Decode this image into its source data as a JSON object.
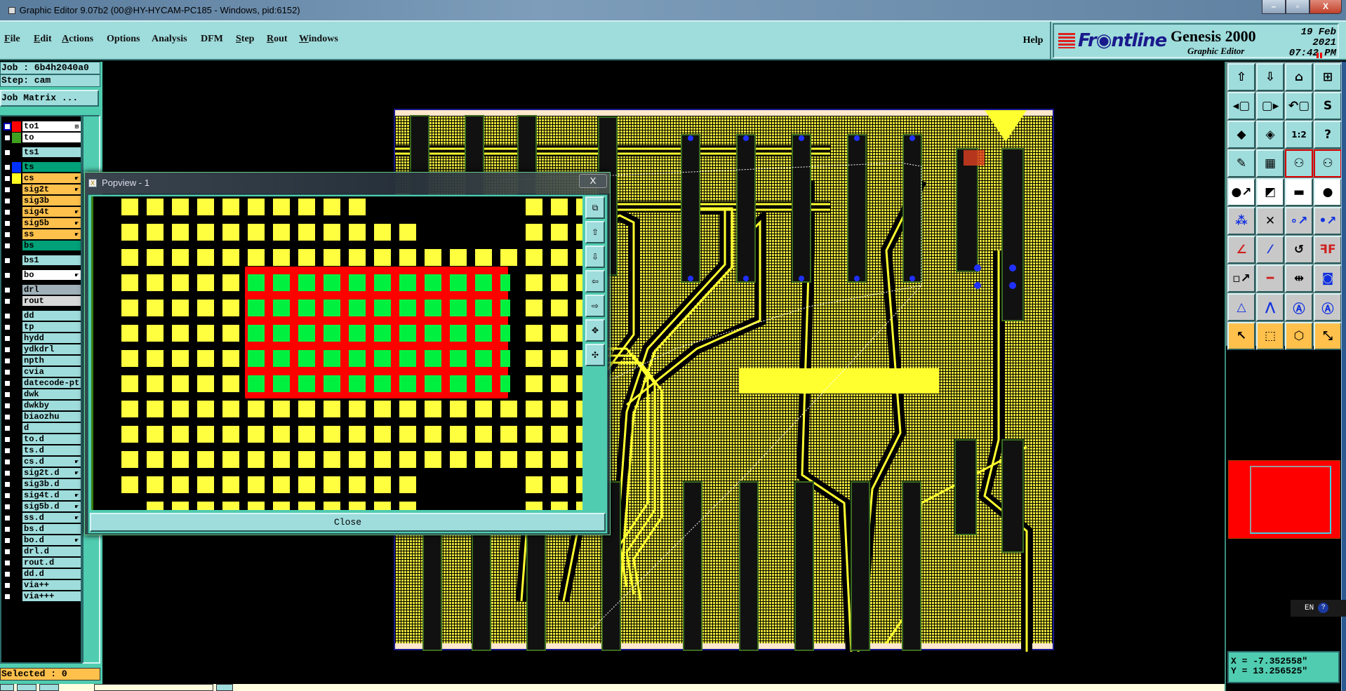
{
  "window": {
    "title": "Graphic Editor 9.07b2 (00@HY-HYCAM-PC185 - Windows, pid:6152)",
    "minimize": "–",
    "maximize": "▫",
    "close": "X"
  },
  "menu": {
    "items": [
      {
        "label": "File",
        "u": "F",
        "rest": "ile"
      },
      {
        "label": "Edit",
        "u": "E",
        "rest": "dit"
      },
      {
        "label": "Actions",
        "u": "A",
        "rest": "ctions"
      },
      {
        "label": "Options",
        "u": "",
        "rest": "Options"
      },
      {
        "label": "Analysis",
        "u": "",
        "rest": "Analysis"
      },
      {
        "label": "DFM",
        "u": "",
        "rest": "DFM"
      },
      {
        "label": "Step",
        "u": "S",
        "rest": "tep"
      },
      {
        "label": "Rout",
        "u": "R",
        "rest": "out"
      },
      {
        "label": "Windows",
        "u": "W",
        "rest": "indows"
      }
    ],
    "help": "Help"
  },
  "logo": {
    "brand": "Fr◉ntline",
    "product": "Genesis 2000",
    "subtitle": "Graphic Editor",
    "date": "19 Feb 2021",
    "time": "07:42 PM"
  },
  "job": {
    "job_line": "Job : 6b4h2040a0",
    "step_line": "Step: cam",
    "matrix_button": "Job Matrix ..."
  },
  "layers": [
    {
      "name": "to1",
      "swatch": "#ff0000",
      "bg": "#ffffff",
      "mark": "⊞",
      "cbborder": "#0000c0"
    },
    {
      "name": "to",
      "swatch": "#40a020",
      "bg": "#ffffff"
    },
    {
      "name": "ts1",
      "bg": "#9fdcdc"
    },
    {
      "name": "ts",
      "swatch": "#0030ff",
      "bg": "#00a078"
    },
    {
      "name": "cs",
      "swatch": "#ffff20",
      "bg": "#ffc04c",
      "hand": true
    },
    {
      "name": "sig2t",
      "bg": "#ffc04c",
      "hand": true
    },
    {
      "name": "sig3b",
      "bg": "#ffc04c"
    },
    {
      "name": "sig4t",
      "bg": "#ffc04c",
      "hand": true
    },
    {
      "name": "sig5b",
      "bg": "#ffc04c",
      "hand": true
    },
    {
      "name": "ss",
      "bg": "#ffc04c",
      "hand": true
    },
    {
      "name": "bs",
      "bg": "#00a078"
    },
    {
      "name": "bs1",
      "bg": "#9fdcdc"
    },
    {
      "name": "bo",
      "bg": "#ffffff",
      "hand": true
    },
    {
      "name": "drl",
      "bg": "#a0b0b8"
    },
    {
      "name": "rout",
      "bg": "#d8d8d8"
    },
    {
      "name": "dd",
      "bg": "#9fdcdc"
    },
    {
      "name": "tp",
      "bg": "#9fdcdc"
    },
    {
      "name": "hydd",
      "bg": "#9fdcdc"
    },
    {
      "name": "ydkdrl",
      "bg": "#9fdcdc"
    },
    {
      "name": "npth",
      "bg": "#9fdcdc"
    },
    {
      "name": "cvia",
      "bg": "#9fdcdc"
    },
    {
      "name": "datecode-pt",
      "bg": "#9fdcdc"
    },
    {
      "name": "dwk",
      "bg": "#9fdcdc"
    },
    {
      "name": "dwkby",
      "bg": "#9fdcdc"
    },
    {
      "name": "biaozhu",
      "bg": "#9fdcdc"
    },
    {
      "name": "d",
      "bg": "#9fdcdc"
    },
    {
      "name": "to.d",
      "bg": "#9fdcdc"
    },
    {
      "name": "ts.d",
      "bg": "#9fdcdc"
    },
    {
      "name": "cs.d",
      "bg": "#9fdcdc",
      "hand": true
    },
    {
      "name": "sig2t.d",
      "bg": "#9fdcdc",
      "hand": true
    },
    {
      "name": "sig3b.d",
      "bg": "#9fdcdc"
    },
    {
      "name": "sig4t.d",
      "bg": "#9fdcdc",
      "hand": true
    },
    {
      "name": "sig5b.d",
      "bg": "#9fdcdc",
      "hand": true
    },
    {
      "name": "ss.d",
      "bg": "#9fdcdc",
      "hand": true
    },
    {
      "name": "bs.d",
      "bg": "#9fdcdc"
    },
    {
      "name": "bo.d",
      "bg": "#9fdcdc",
      "hand": true
    },
    {
      "name": "drl.d",
      "bg": "#9fdcdc"
    },
    {
      "name": "rout.d",
      "bg": "#9fdcdc"
    },
    {
      "name": "dd.d",
      "bg": "#9fdcdc"
    },
    {
      "name": "via++",
      "bg": "#9fdcdc"
    },
    {
      "name": "via+++",
      "bg": "#9fdcdc"
    }
  ],
  "status": {
    "selected": "Selected : 0"
  },
  "popview": {
    "title": "Popview - 1",
    "close_x": "X",
    "close_button": "Close",
    "tools": [
      "zoom-window-icon",
      "pan-up-icon",
      "pan-down-icon",
      "pan-left-icon",
      "pan-right-icon",
      "zoom-in-icon",
      "zoom-out-icon"
    ]
  },
  "toolbar": [
    {
      "icon": "move-up-icon",
      "g": "⇧"
    },
    {
      "icon": "move-down-icon",
      "g": "⇩"
    },
    {
      "icon": "home-icon",
      "g": "⌂"
    },
    {
      "icon": "window-xy-icon",
      "g": "⊞"
    },
    {
      "icon": "pan-left-icon",
      "g": "◂▢"
    },
    {
      "icon": "pan-right-icon",
      "g": "▢▸"
    },
    {
      "icon": "undo-view-icon",
      "g": "↶▢"
    },
    {
      "icon": "snake-icon",
      "g": "S"
    },
    {
      "icon": "zoom-fit-icon",
      "g": "◆"
    },
    {
      "icon": "zoom-center-icon",
      "g": "◈"
    },
    {
      "icon": "scale-icon",
      "g": "1:2"
    },
    {
      "icon": "help-icon",
      "g": "?"
    },
    {
      "icon": "tools-icon",
      "g": "✎"
    },
    {
      "icon": "grid-icon",
      "g": "▦"
    },
    {
      "icon": "net-highlight-icon",
      "g": "⚇",
      "c": "r"
    },
    {
      "icon": "net-highlight-alt-icon",
      "g": "⚇",
      "c": "r"
    },
    {
      "icon": "add-feature-icon",
      "g": "●↗",
      "c": "w"
    },
    {
      "icon": "measure-window-icon",
      "g": "◩",
      "c": "w"
    },
    {
      "icon": "ruler-icon",
      "g": "▬",
      "c": "w"
    },
    {
      "icon": "pad-icon",
      "g": "●",
      "c": "w"
    },
    {
      "icon": "connect-icon",
      "g": "⁂",
      "c": "g"
    },
    {
      "icon": "delete-point-icon",
      "g": "✕",
      "c": "g"
    },
    {
      "icon": "move-point-icon",
      "g": "∘↗",
      "c": "g"
    },
    {
      "icon": "move-point-alt-icon",
      "g": "•↗",
      "c": "g"
    },
    {
      "icon": "slope-icon",
      "g": "∠",
      "c": "g"
    },
    {
      "icon": "line-edit-icon",
      "g": "⁄",
      "c": "g"
    },
    {
      "icon": "rotate-icon",
      "g": "↺",
      "c": "g"
    },
    {
      "icon": "mirror-icon",
      "g": "ꟻF",
      "c": "g"
    },
    {
      "icon": "move-pad-icon",
      "g": "▫↗",
      "c": "g"
    },
    {
      "icon": "line-icon",
      "g": "━",
      "c": "g"
    },
    {
      "icon": "dimension-icon",
      "g": "⇹",
      "c": "g"
    },
    {
      "icon": "shapes-icon",
      "g": "◙",
      "c": "g"
    },
    {
      "icon": "triangle-icon",
      "g": "△",
      "c": "g"
    },
    {
      "icon": "double-arc-icon",
      "g": "⋀",
      "c": "g"
    },
    {
      "icon": "arc-icon",
      "g": "Ⓐ",
      "c": "g"
    },
    {
      "icon": "arc-cross-icon",
      "g": "Ⓐ",
      "c": "g"
    },
    {
      "icon": "select-arrow-icon",
      "g": "↖",
      "c": "o"
    },
    {
      "icon": "select-box-icon",
      "g": "⬚",
      "c": "o"
    },
    {
      "icon": "select-polygon-icon",
      "g": "⬡",
      "c": "o"
    },
    {
      "icon": "select-net-icon",
      "g": "⤡",
      "c": "o"
    }
  ],
  "coords": {
    "x": "X = -7.352558\"",
    "y": "Y = 13.256525\""
  },
  "ime": {
    "lang": "EN",
    "help": "?"
  },
  "colors": {
    "pad": "#ffff40",
    "selected_pad": "#00f040",
    "selection": "#ff0000",
    "board": "#e8e43a"
  }
}
